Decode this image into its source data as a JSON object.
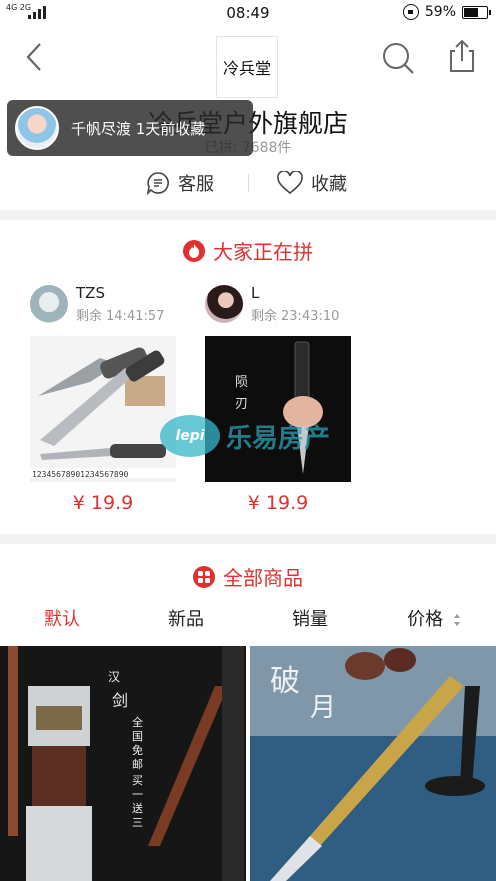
{
  "status_bar": {
    "network": "4G 2G",
    "time": "08:49",
    "battery": "59%"
  },
  "header": {
    "logo_text": "冷兵堂",
    "store_name": "冷兵堂户外旗舰店",
    "sold_label": "已拼: 7688件",
    "service_label": "客服",
    "favorite_label": "收藏"
  },
  "toast": {
    "message": "千帆尽渡 1天前收藏"
  },
  "group_buying": {
    "title": "大家正在拼",
    "cards": [
      {
        "name": "TZS",
        "remain_label": "剩余",
        "remain_time": "14:41:57",
        "price": "¥ 19.9"
      },
      {
        "name": "L",
        "remain_label": "剩余",
        "remain_time": "23:43:10",
        "price": "¥ 19.9"
      }
    ]
  },
  "all_products": {
    "title": "全部商品",
    "tabs": [
      "默认",
      "新品",
      "销量",
      "价格"
    ],
    "active_tab": "默认"
  },
  "watermark": {
    "logo": "lepi",
    "text": "乐易房产"
  },
  "colors": {
    "accent": "#e0312e",
    "muted": "#999999"
  }
}
